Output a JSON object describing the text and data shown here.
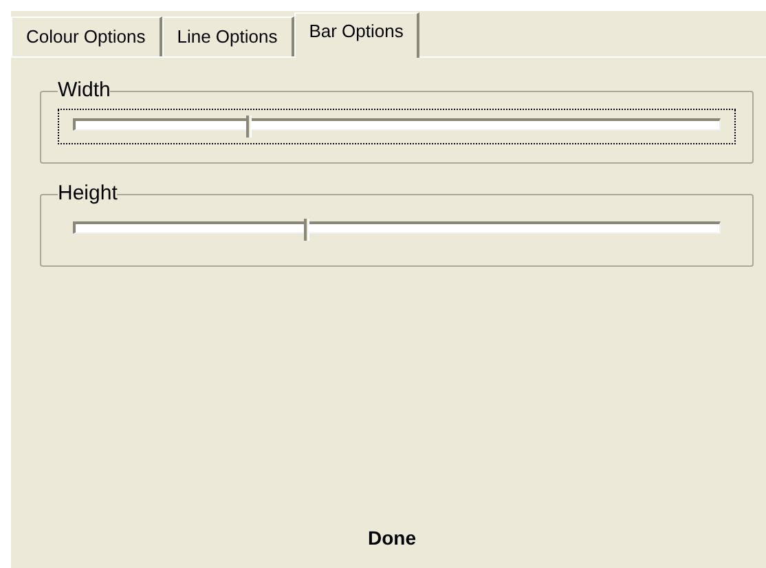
{
  "tabs": [
    {
      "label": "Colour Options",
      "selected": false
    },
    {
      "label": "Line Options",
      "selected": false
    },
    {
      "label": "Bar Options",
      "selected": true
    }
  ],
  "sliders": [
    {
      "label": "Width",
      "level": 0.265,
      "focused": true
    },
    {
      "label": "Height",
      "level": 0.354,
      "focused": false
    }
  ],
  "status": "Done"
}
